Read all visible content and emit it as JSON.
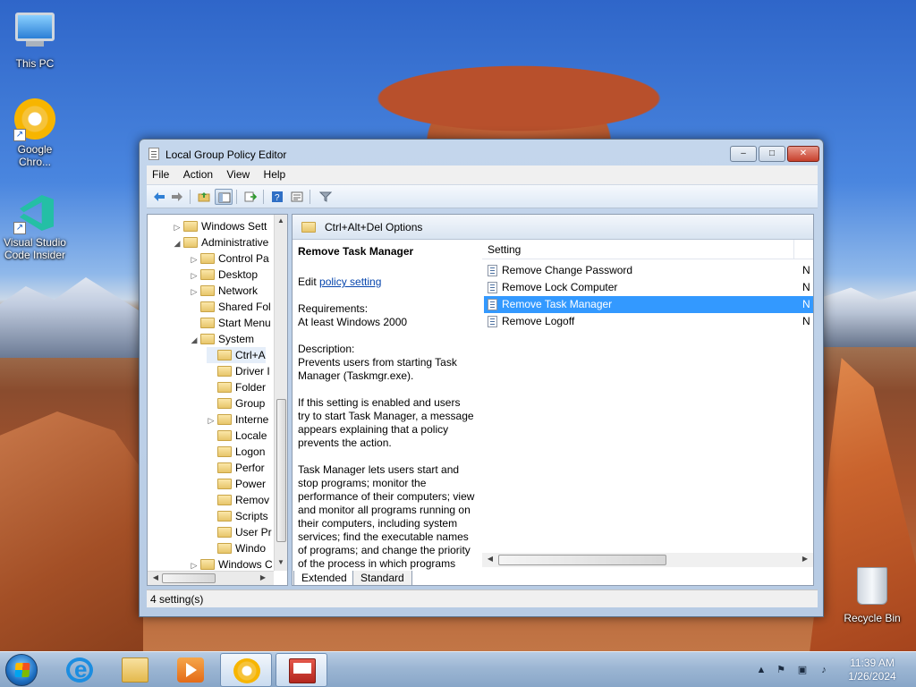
{
  "desktop": {
    "icons": [
      {
        "label": "This PC"
      },
      {
        "label": "Google Chro..."
      },
      {
        "label": "Visual Studio Code Insider"
      },
      {
        "label": "Recycle Bin"
      }
    ]
  },
  "window": {
    "title": "Local Group Policy Editor",
    "buttons": {
      "minimize": "‒",
      "maximize": "□",
      "close": "✕"
    },
    "menu": [
      "File",
      "Action",
      "View",
      "Help"
    ],
    "toolbar_icons": [
      "back-icon",
      "forward-icon",
      "up-folder-icon",
      "show-hide-tree-icon",
      "export-list-icon",
      "help-icon",
      "properties-icon",
      "filter-icon"
    ],
    "tree": [
      {
        "label": "Windows Sett",
        "arrow": "▷",
        "indent": 0
      },
      {
        "label": "Administrative",
        "arrow": "◢",
        "indent": 0
      },
      {
        "label": "Control Pa",
        "arrow": "▷",
        "indent": 1
      },
      {
        "label": "Desktop",
        "arrow": "▷",
        "indent": 1
      },
      {
        "label": "Network",
        "arrow": "▷",
        "indent": 1
      },
      {
        "label": "Shared Fol",
        "arrow": "",
        "indent": 1
      },
      {
        "label": "Start Menu",
        "arrow": "",
        "indent": 1
      },
      {
        "label": "System",
        "arrow": "◢",
        "indent": 1
      },
      {
        "label": "Ctrl+A",
        "arrow": "",
        "indent": 2
      },
      {
        "label": "Driver I",
        "arrow": "",
        "indent": 2
      },
      {
        "label": "Folder",
        "arrow": "",
        "indent": 2
      },
      {
        "label": "Group",
        "arrow": "",
        "indent": 2
      },
      {
        "label": "Interne",
        "arrow": "▷",
        "indent": 2
      },
      {
        "label": "Locale",
        "arrow": "",
        "indent": 2
      },
      {
        "label": "Logon",
        "arrow": "",
        "indent": 2
      },
      {
        "label": "Perfor",
        "arrow": "",
        "indent": 2
      },
      {
        "label": "Power",
        "arrow": "",
        "indent": 2
      },
      {
        "label": "Remov",
        "arrow": "",
        "indent": 2
      },
      {
        "label": "Scripts",
        "arrow": "",
        "indent": 2
      },
      {
        "label": "User Pr",
        "arrow": "",
        "indent": 2
      },
      {
        "label": "Windo",
        "arrow": "",
        "indent": 2
      },
      {
        "label": "Windows C",
        "arrow": "▷",
        "indent": 1
      }
    ],
    "right_header": "Ctrl+Alt+Del Options",
    "description": {
      "heading": "Remove Task Manager",
      "edit_prefix": "Edit ",
      "edit_link": "policy setting",
      "requirements_label": "Requirements:",
      "requirements_value": "At least Windows 2000",
      "description_label": "Description:",
      "description_text": "Prevents users from starting Task Manager (Taskmgr.exe).",
      "para2": "If this setting is enabled and users try to start Task Manager, a message appears explaining that a policy prevents the action.",
      "para3": "Task Manager lets users start and stop programs; monitor the performance of their computers; view and monitor all programs running on their computers, including system services; find the executable names of programs; and change the priority of the process in which programs run."
    },
    "list": {
      "column_setting": "Setting",
      "rows": [
        {
          "name": "Remove Change Password",
          "state": "N"
        },
        {
          "name": "Remove Lock Computer",
          "state": "N"
        },
        {
          "name": "Remove Task Manager",
          "state": "N"
        },
        {
          "name": "Remove Logoff",
          "state": "N"
        }
      ]
    },
    "tabs": [
      "Extended",
      "Standard"
    ],
    "status": "4 setting(s)"
  },
  "taskbar": {
    "clock_time": "11:39 AM",
    "clock_date": "1/26/2024",
    "tray_icons": [
      "show-hidden-icons",
      "action-center-icon",
      "network-icon",
      "volume-muted-icon"
    ]
  }
}
